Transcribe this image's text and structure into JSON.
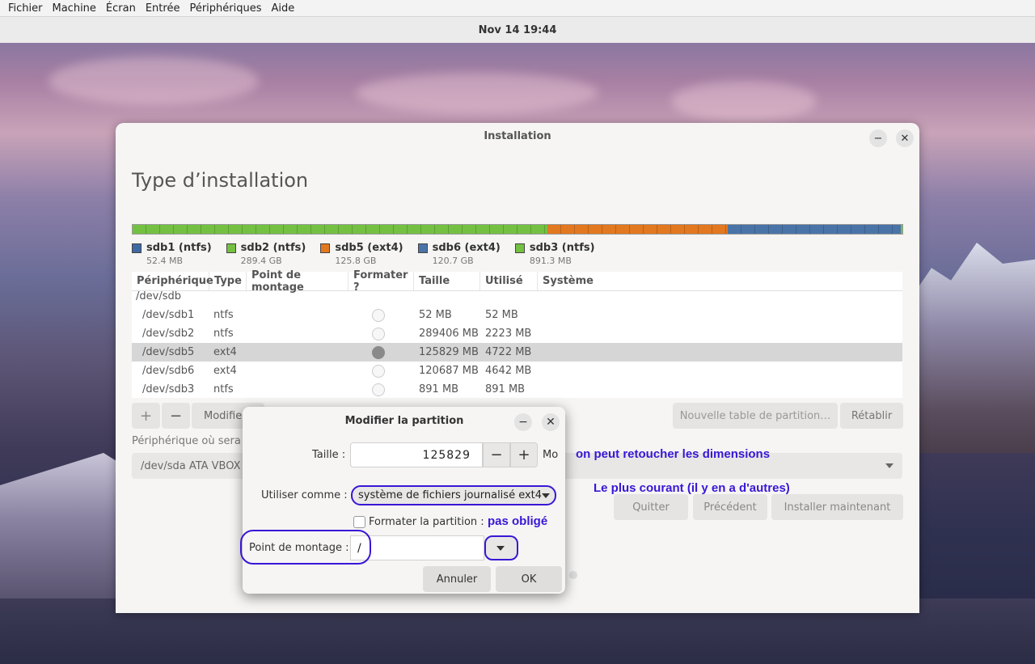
{
  "menubar": {
    "items": [
      "Fichier",
      "Machine",
      "Écran",
      "Entrée",
      "Périphériques",
      "Aide"
    ]
  },
  "clock": "Nov 14  19:44",
  "window": {
    "title": "Installation",
    "heading": "Type d’installation"
  },
  "partitions_bar": [
    {
      "name": "sdb1 (ntfs)",
      "size": "52.4 MB",
      "color": "#3e6aa4",
      "fraction": 0.0001
    },
    {
      "name": "sdb2 (ntfs)",
      "size": "289.4 GB",
      "color": "#74c043",
      "fraction": 0.539
    },
    {
      "name": "sdb5 (ext4)",
      "size": "125.8 GB",
      "color": "#e2781f",
      "fraction": 0.235
    },
    {
      "name": "sdb6 (ext4)",
      "size": "120.7 GB",
      "color": "#4a74a8",
      "fraction": 0.225
    },
    {
      "name": "sdb3 (ntfs)",
      "size": "891.3 MB",
      "color": "#74c043",
      "fraction": 0.002
    }
  ],
  "table": {
    "headers": [
      "Périphérique",
      "Type",
      "Point de montage",
      "Formater ?",
      "Taille",
      "Utilisé",
      "Système"
    ],
    "device": "/dev/sdb",
    "rows": [
      {
        "dev": "/dev/sdb1",
        "type": "ntfs",
        "size": "52 MB",
        "used": "52 MB"
      },
      {
        "dev": "/dev/sdb2",
        "type": "ntfs",
        "size": "289406 MB",
        "used": "2223 MB"
      },
      {
        "dev": "/dev/sdb5",
        "type": "ext4",
        "size": "125829 MB",
        "used": "4722 MB"
      },
      {
        "dev": "/dev/sdb6",
        "type": "ext4",
        "size": "120687 MB",
        "used": "4642 MB"
      },
      {
        "dev": "/dev/sdb3",
        "type": "ntfs",
        "size": "891 MB",
        "used": "891 MB"
      }
    ]
  },
  "toolbar": {
    "add": "+",
    "remove": "−",
    "modify": "Modifie",
    "new_table": "Nouvelle table de partition…",
    "revert": "Rétablir"
  },
  "bootloader": {
    "label": "Périphérique où sera l",
    "device": "/dev/sda   ATA VBOX"
  },
  "nav": {
    "quit": "Quitter",
    "back": "Précédent",
    "install": "Installer maintenant"
  },
  "dialog": {
    "title": "Modifier la partition",
    "size_label": "Taille :",
    "size_value": "125829",
    "size_unit": "Mo",
    "use_as_label": "Utiliser comme :",
    "use_as_value": "système de fichiers journalisé ext4",
    "format_label": "Formater la partition :",
    "mount_label": "Point de montage :",
    "mount_value": "/",
    "cancel": "Annuler",
    "ok": "OK"
  },
  "annotations": {
    "dimensions": "on peut retoucher les  dimensions",
    "common": "Le plus courant (il y en a d'autres)",
    "optional": "pas obligé"
  },
  "colors": {
    "annotation": "#3a16d6"
  }
}
